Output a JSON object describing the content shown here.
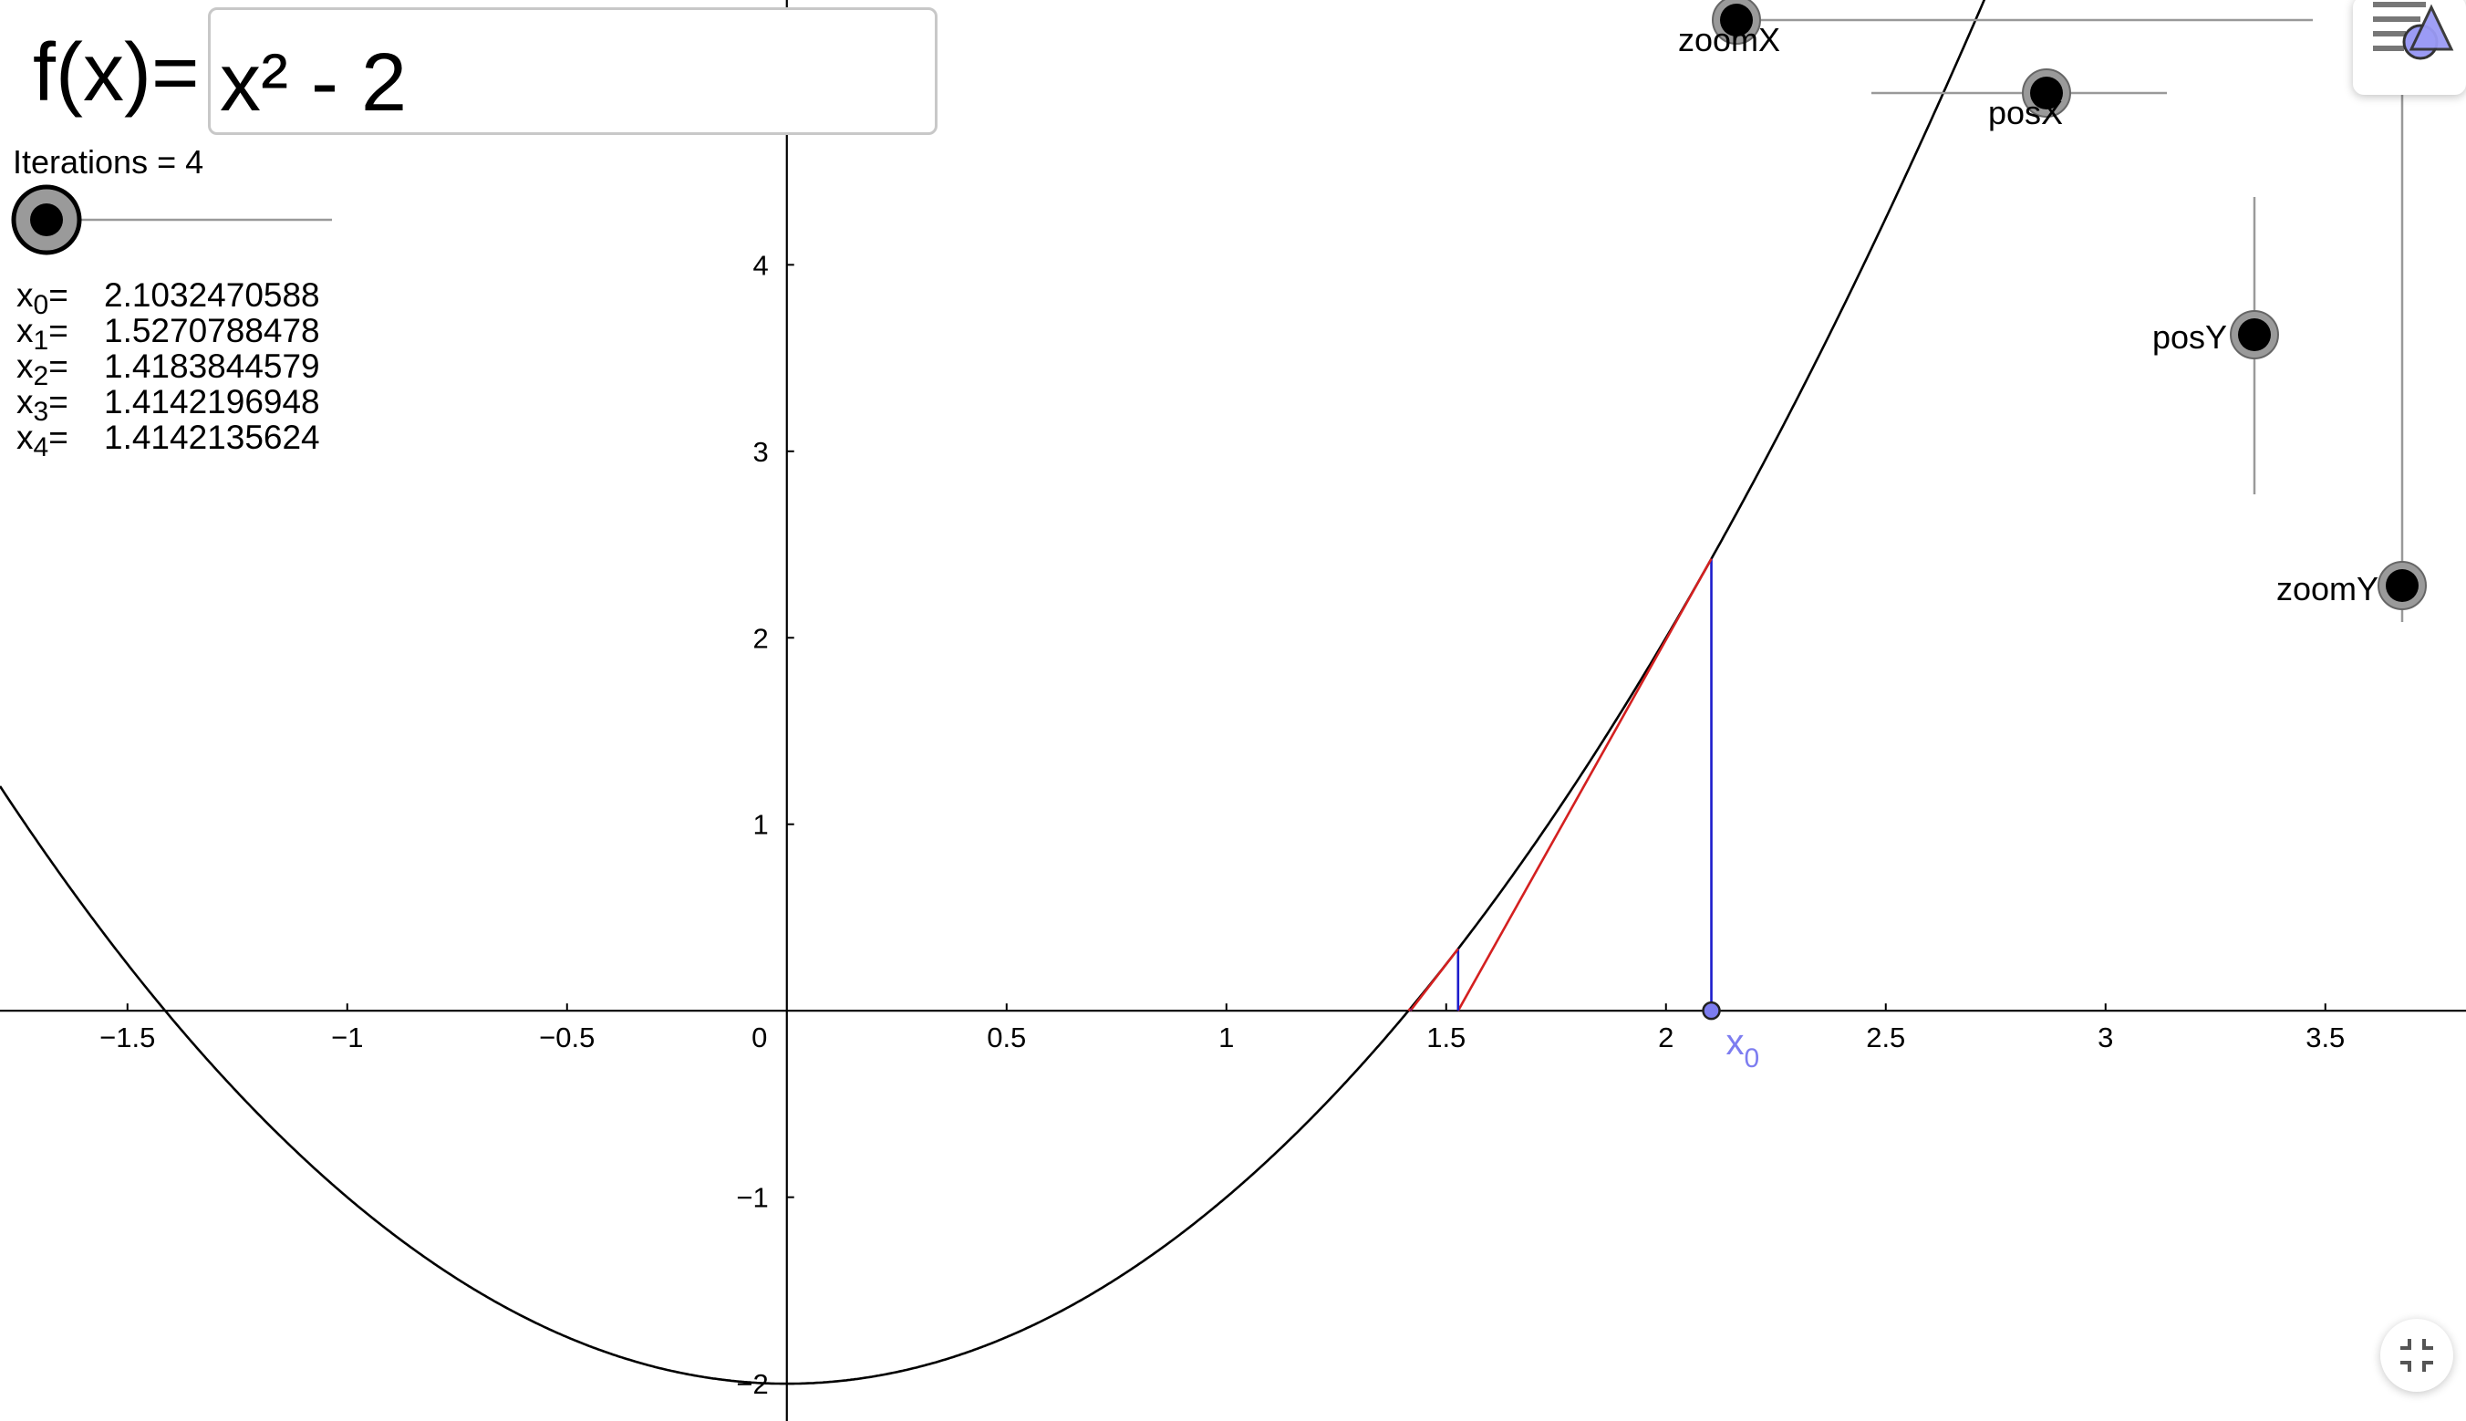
{
  "function": {
    "label": "f(x)=",
    "input_value": "x² - 2"
  },
  "iterations": {
    "label": "Iterations = 4",
    "slider_fraction": 0.0
  },
  "iterates": [
    {
      "name": "x",
      "index": "0",
      "eq": "=",
      "value": "2.1032470588"
    },
    {
      "name": "x",
      "index": "1",
      "eq": "=",
      "value": "1.5270788478"
    },
    {
      "name": "x",
      "index": "2",
      "eq": "=",
      "value": "1.4183844579"
    },
    {
      "name": "x",
      "index": "3",
      "eq": "=",
      "value": "1.4142196948"
    },
    {
      "name": "x",
      "index": "4",
      "eq": "=",
      "value": "1.4142135624"
    }
  ],
  "sliders": {
    "zoomX": "zoomX",
    "posX": "posX",
    "posY": "posY",
    "zoomY": "zoomY"
  },
  "point_label": {
    "name": "x",
    "index": "0"
  },
  "icons": {
    "menu": "graphics-style-menu-icon",
    "fullscreen": "exit-fullscreen-icon"
  },
  "colors": {
    "curve": "#000000",
    "tangent": "#d42020",
    "vertical": "#1c1ccc",
    "point": "#7d7df0",
    "axis": "#000000"
  },
  "chart_data": {
    "type": "line",
    "function": "x^2 - 2",
    "x_ticks": [
      "−1.5",
      "−1",
      "−0.5",
      "0",
      "0.5",
      "1",
      "1.5",
      "2",
      "2.5",
      "3",
      "3.5"
    ],
    "y_ticks": [
      "−2",
      "−1",
      "1",
      "2",
      "3",
      "4"
    ],
    "x_tick_values": [
      -1.5,
      -1,
      -0.5,
      0,
      0.5,
      1,
      1.5,
      2,
      2.5,
      3,
      3.5
    ],
    "y_tick_values": [
      -2,
      -1,
      1,
      2,
      3,
      4
    ],
    "xlim": [
      -1.79,
      3.82
    ],
    "ylim": [
      -2.2,
      5.42
    ],
    "grid": false,
    "x0": 2.1032470588,
    "newton_iterates": [
      2.1032470588,
      1.5270788478,
      1.4183844579,
      1.4142196948,
      1.4142135624
    ]
  }
}
